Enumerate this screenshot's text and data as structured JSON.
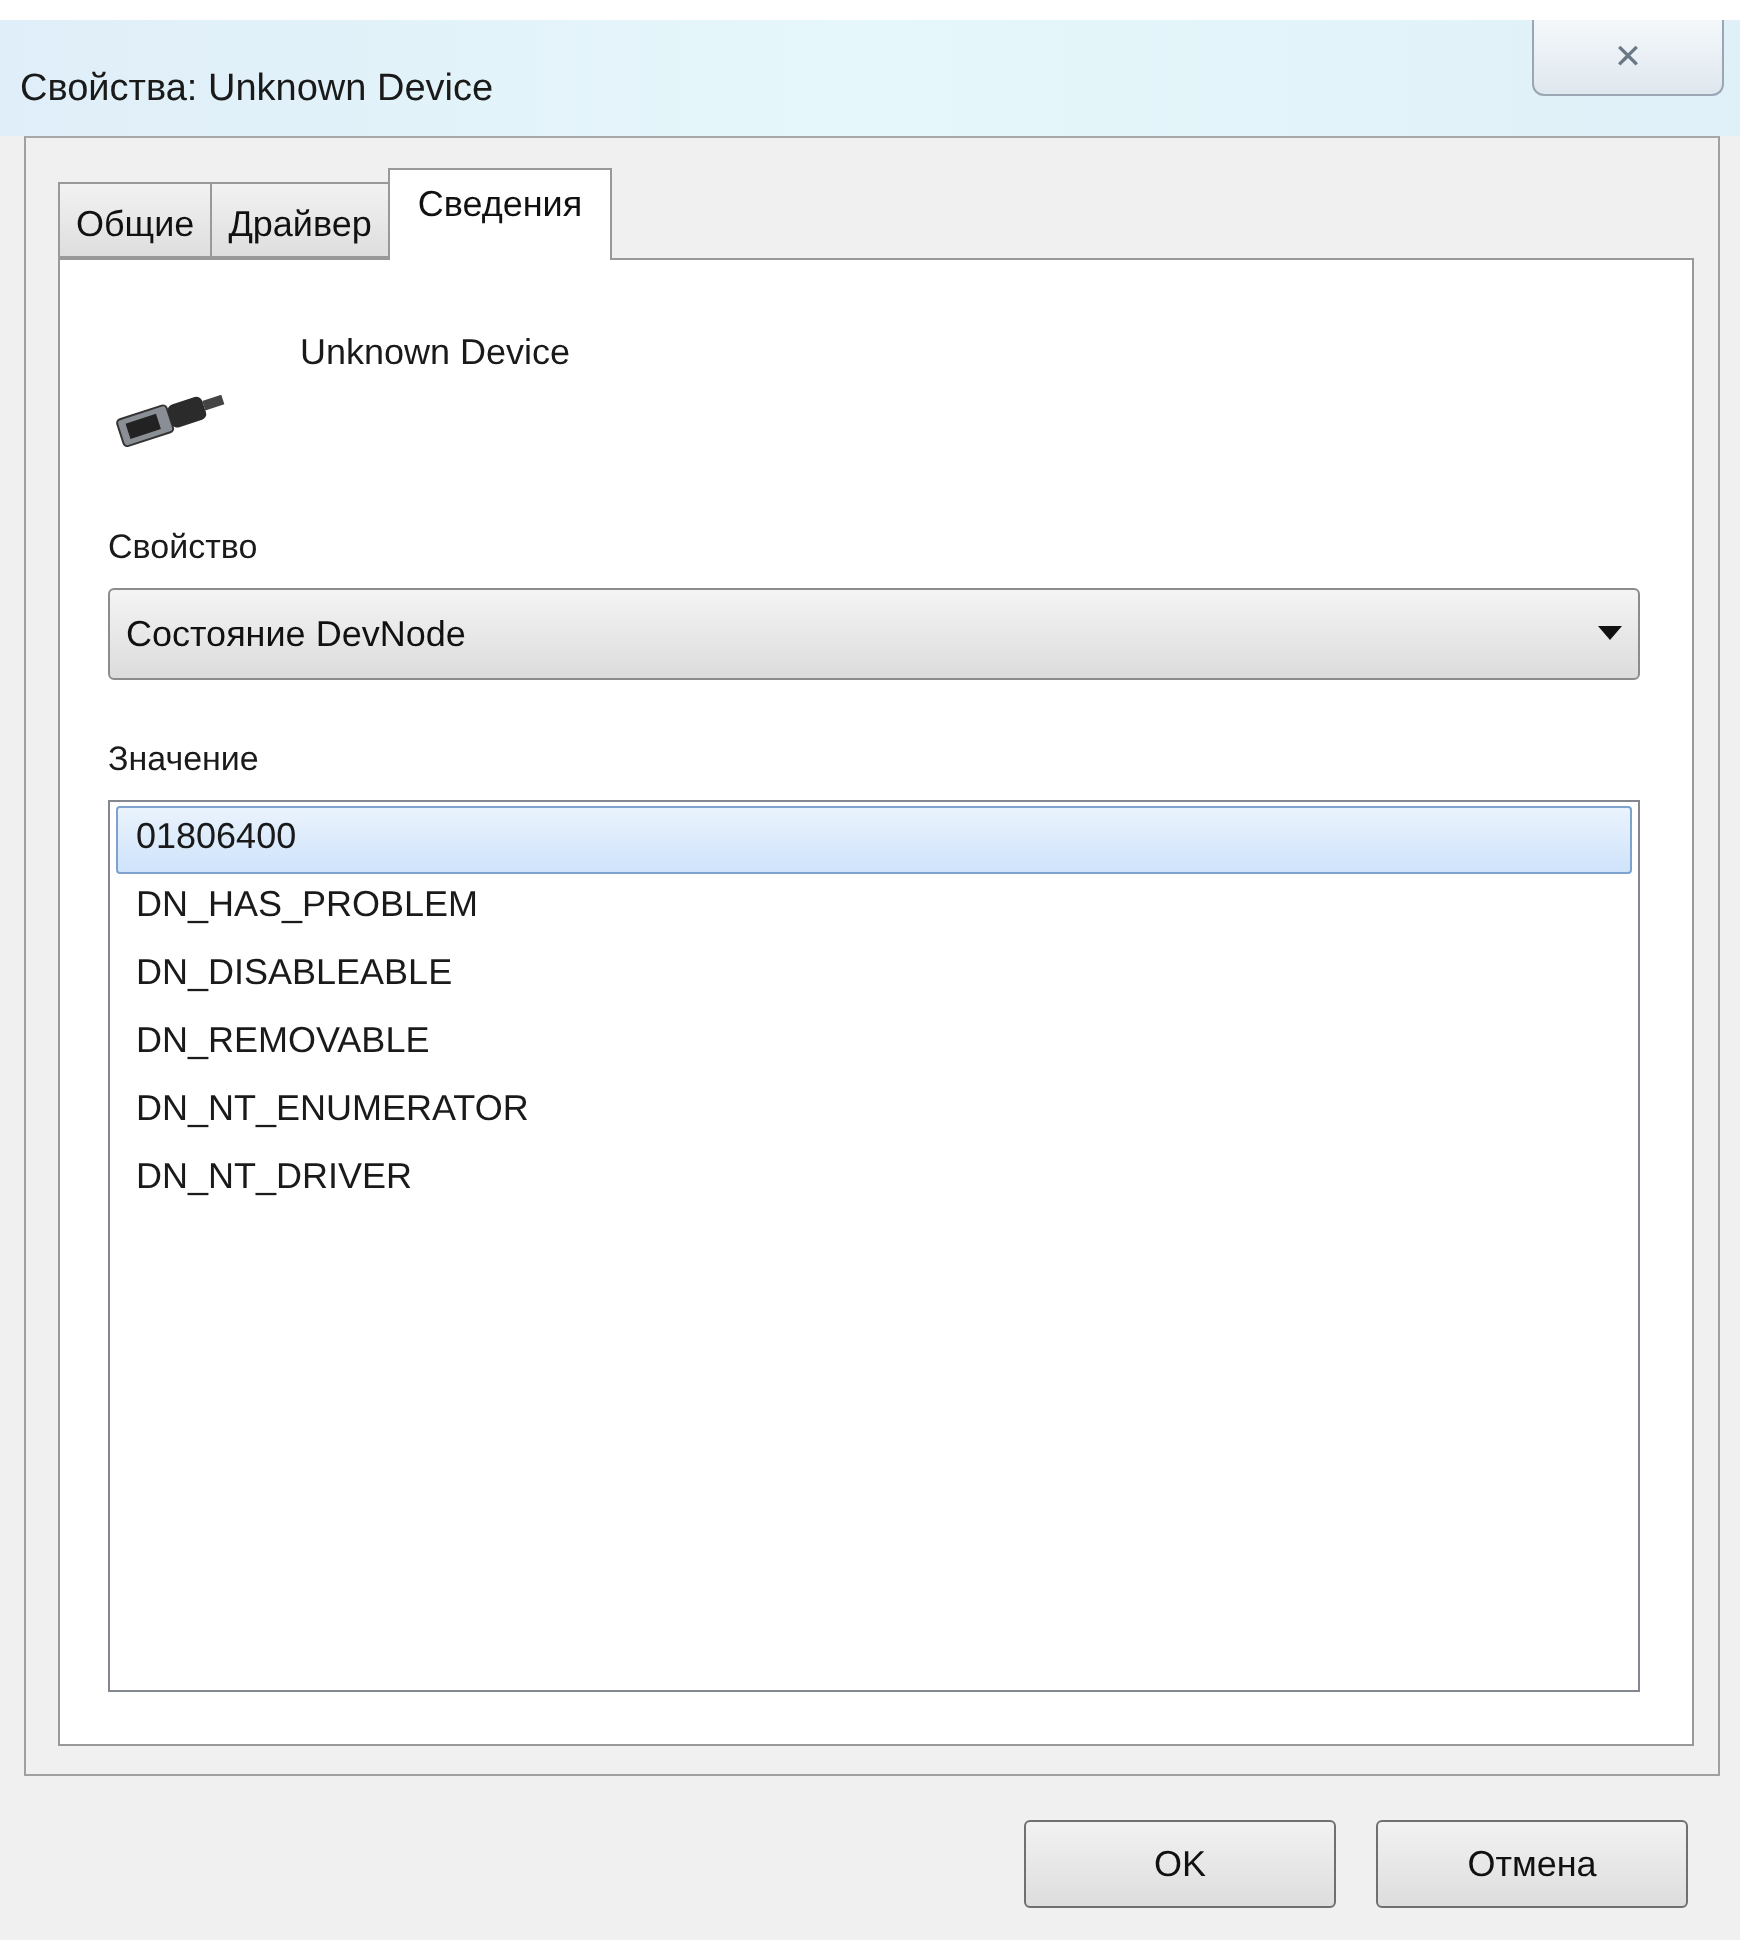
{
  "window": {
    "title": "Свойства: Unknown Device",
    "close": "✕"
  },
  "tabs": [
    {
      "label": "Общие",
      "selected": false
    },
    {
      "label": "Драйвер",
      "selected": false
    },
    {
      "label": "Сведения",
      "selected": true
    }
  ],
  "device": {
    "name": "Unknown Device"
  },
  "property": {
    "label": "Свойство",
    "value": "Состояние DevNode"
  },
  "values": {
    "label": "Значение",
    "items": [
      {
        "text": "01806400",
        "selected": true
      },
      {
        "text": "DN_HAS_PROBLEM",
        "selected": false
      },
      {
        "text": "DN_DISABLEABLE",
        "selected": false
      },
      {
        "text": "DN_REMOVABLE",
        "selected": false
      },
      {
        "text": "DN_NT_ENUMERATOR",
        "selected": false
      },
      {
        "text": "DN_NT_DRIVER",
        "selected": false
      }
    ]
  },
  "buttons": [
    "OK",
    "Отмена"
  ]
}
